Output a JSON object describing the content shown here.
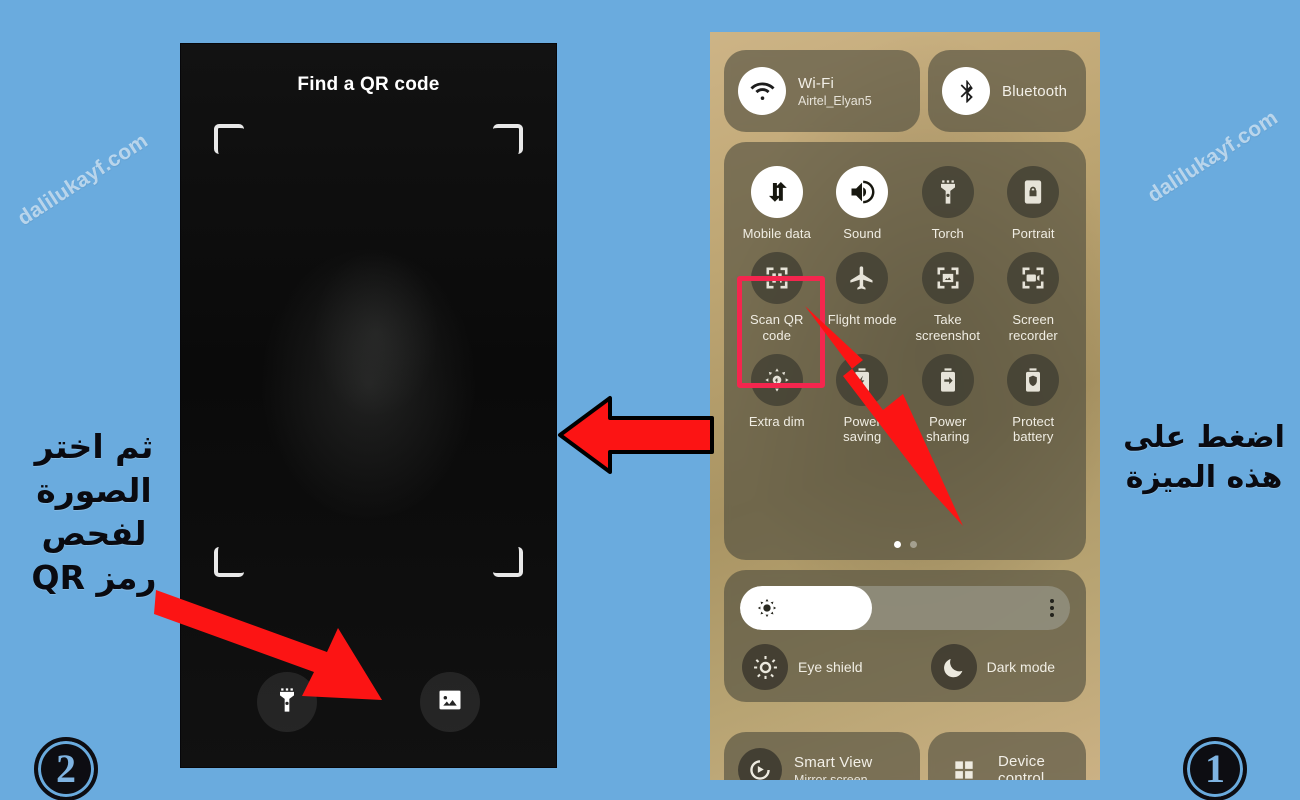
{
  "page": {
    "background_color": "#6aabde",
    "watermark_text": "dalilukayf.com",
    "accent_red": "#f4264e",
    "arrow_red": "#fc1414"
  },
  "steps": {
    "step_one_label": "1",
    "step_two_label": "2"
  },
  "captions": {
    "left": "ثم اختر الصورة لفحص رمز QR",
    "right": "اضغط على هذه الميزة"
  },
  "qr_screen": {
    "title": "Find a QR code",
    "torch_icon": "flashlight-icon",
    "gallery_icon": "image-icon"
  },
  "quick_panel": {
    "wifi": {
      "title": "Wi-Fi",
      "subtitle": "Airtel_Elyan5",
      "icon": "wifi-icon",
      "on": true
    },
    "bluetooth": {
      "title": "Bluetooth",
      "icon": "bluetooth-icon",
      "on": true
    },
    "toggles": [
      {
        "label": "Mobile data",
        "icon": "mobile-data-icon",
        "on": true
      },
      {
        "label": "Sound",
        "icon": "sound-icon",
        "on": true
      },
      {
        "label": "Torch",
        "icon": "torch-icon",
        "on": false
      },
      {
        "label": "Portrait",
        "icon": "rotation-lock-icon",
        "on": false
      },
      {
        "label": "Scan QR code",
        "icon": "scan-qr-icon",
        "on": false
      },
      {
        "label": "Flight mode",
        "icon": "airplane-icon",
        "on": false
      },
      {
        "label": "Take screenshot",
        "icon": "screenshot-icon",
        "on": false
      },
      {
        "label": "Screen recorder",
        "icon": "screen-recorder-icon",
        "on": false
      },
      {
        "label": "Extra dim",
        "icon": "extra-dim-icon",
        "on": false
      },
      {
        "label": "Power saving",
        "icon": "power-saving-icon",
        "on": false
      },
      {
        "label": "Power sharing",
        "icon": "power-sharing-icon",
        "on": false
      },
      {
        "label": "Protect battery",
        "icon": "protect-battery-icon",
        "on": false
      }
    ],
    "pages": {
      "count": 2,
      "active": 1
    },
    "brightness": {
      "value_percent": 40,
      "icon": "brightness-icon",
      "more_icon": "more-options-icon"
    },
    "eye_shield": {
      "label": "Eye shield",
      "icon": "eye-shield-icon"
    },
    "dark_mode": {
      "label": "Dark mode",
      "icon": "moon-icon"
    },
    "smart_view": {
      "title": "Smart View",
      "subtitle": "Mirror screen",
      "icon": "smart-view-icon"
    },
    "device_control": {
      "title": "Device control",
      "icon": "device-control-icon"
    }
  }
}
